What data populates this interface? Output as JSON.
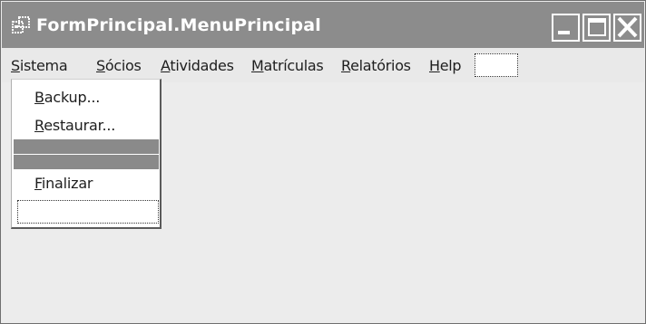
{
  "window": {
    "title": "FormPrincipal.MenuPrincipal",
    "app_icon": "app-window-icon",
    "controls": {
      "minimize_icon": "minimize-icon",
      "maximize_icon": "maximize-icon",
      "close_icon": "close-icon"
    }
  },
  "menubar": {
    "items": [
      {
        "key": "S",
        "rest": "istema"
      },
      {
        "key": "S",
        "rest": "ócios"
      },
      {
        "key": "A",
        "rest": "tividades"
      },
      {
        "key": "M",
        "rest": "atrículas"
      },
      {
        "key": "R",
        "rest": "elatórios"
      },
      {
        "key": "H",
        "rest": "elp"
      }
    ]
  },
  "dropdown": {
    "items": [
      {
        "key": "B",
        "rest": "ackup..."
      },
      {
        "key": "R",
        "rest": "estaurar..."
      },
      {
        "key": "F",
        "rest": "inalizar"
      }
    ]
  },
  "colors": {
    "titlebar": "#8c8c8c",
    "client_area": "#ececec",
    "separator": "#8a8a8a"
  }
}
